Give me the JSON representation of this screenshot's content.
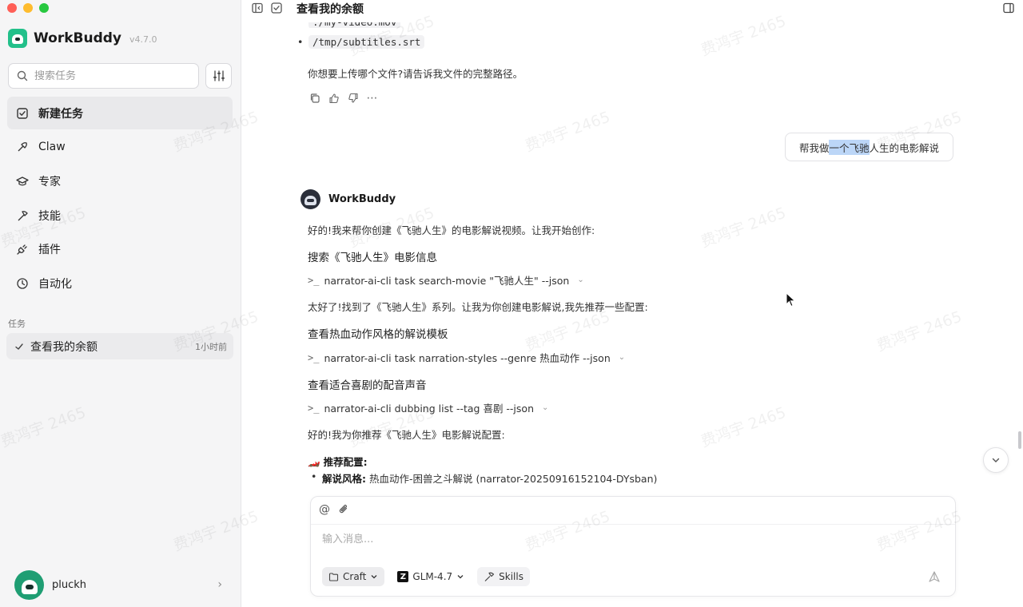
{
  "app": {
    "name": "WorkBuddy",
    "version": "v4.7.0"
  },
  "sidebar": {
    "search_placeholder": "搜索任务",
    "items": [
      {
        "label": "新建任务",
        "icon": "new-task-icon"
      },
      {
        "label": "Claw",
        "icon": "claw-icon"
      },
      {
        "label": "专家",
        "icon": "expert-icon"
      },
      {
        "label": "技能",
        "icon": "skills-icon"
      },
      {
        "label": "插件",
        "icon": "plugin-icon"
      },
      {
        "label": "自动化",
        "icon": "automation-icon"
      }
    ],
    "section_label": "任务",
    "tasks": [
      {
        "title": "查看我的余额",
        "time": "1小时前"
      }
    ],
    "user": {
      "name": "pluckh"
    }
  },
  "topbar": {
    "title": "查看我的余额"
  },
  "chat": {
    "file_bullet_partial": "./my-video.mov",
    "file_bullet": "/tmp/subtitles.srt",
    "ask_file": "你想要上传哪个文件?请告诉我文件的完整路径。",
    "user_message_pre": "帮我做",
    "user_message_hl": "一个飞驰",
    "user_message_post": "人生的电影解说",
    "bot_name": "WorkBuddy",
    "reply_intro": "好的!我来帮你创建《飞驰人生》的电影解说视频。让我开始创作:",
    "step1_title": "搜索《飞驰人生》电影信息",
    "step1_cmd": "narrator-ai-cli task search-movie \"飞驰人生\" --json",
    "step1_result": "太好了!找到了《飞驰人生》系列。让我为你创建电影解说,我先推荐一些配置:",
    "step2_title": "查看热血动作风格的解说模板",
    "step2_cmd": "narrator-ai-cli task narration-styles --genre 热血动作 --json",
    "step3_title": "查看适合喜剧的配音声音",
    "step3_cmd": "narrator-ai-cli dubbing list --tag 喜剧 --json",
    "step3_result": "好的!我为你推荐《飞驰人生》电影解说配置:",
    "rec_title": "推荐配置:",
    "rec_emoji": "🏎️",
    "rec_item_label": "解说风格:",
    "rec_item_value": " 热血动作-困兽之斗解说 (narrator-20250916152104-DYsban)",
    "prompt_symbol": ">_"
  },
  "composer": {
    "placeholder": "输入消息...",
    "mode": "Craft",
    "model": "GLM-4.7",
    "model_logo": "Z",
    "skills": "Skills"
  },
  "watermark": "费鸿宇 2465",
  "colors": {
    "accent": "#22c08a",
    "highlight": "#bcd6f7"
  }
}
